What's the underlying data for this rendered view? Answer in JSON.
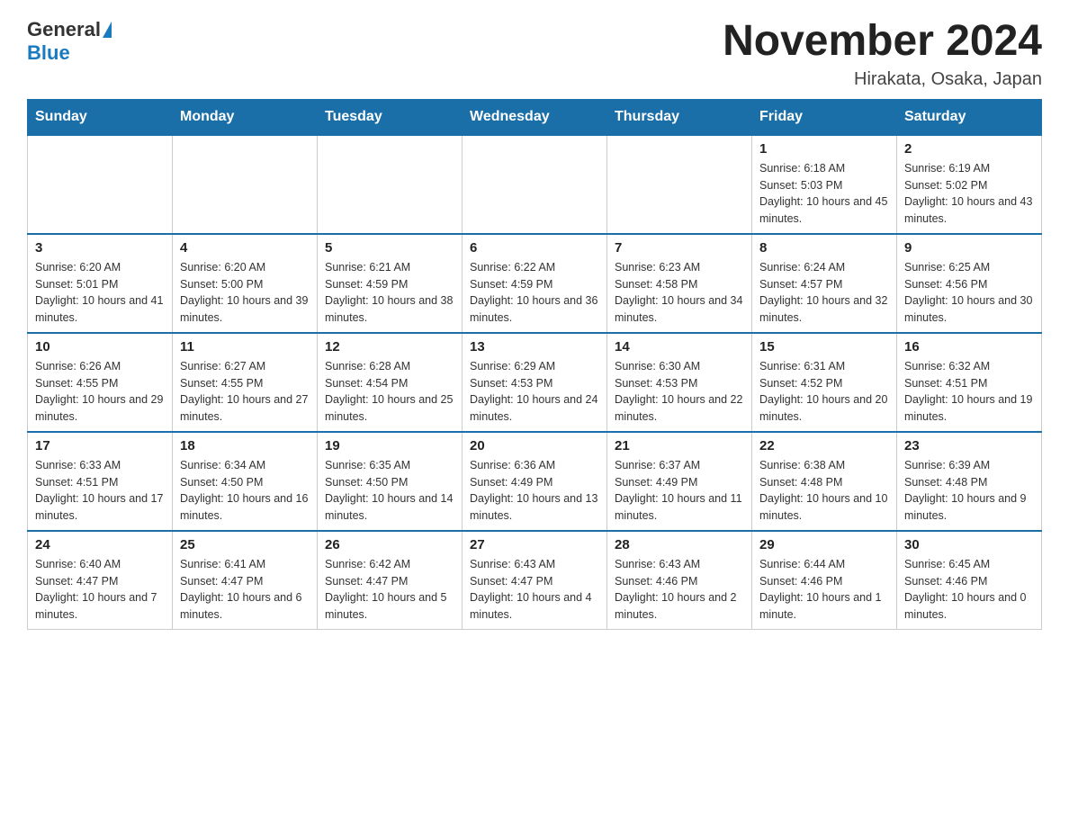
{
  "header": {
    "logo_general": "General",
    "logo_blue": "Blue",
    "month_title": "November 2024",
    "location": "Hirakata, Osaka, Japan"
  },
  "weekdays": [
    "Sunday",
    "Monday",
    "Tuesday",
    "Wednesday",
    "Thursday",
    "Friday",
    "Saturday"
  ],
  "weeks": [
    [
      {
        "day": "",
        "info": ""
      },
      {
        "day": "",
        "info": ""
      },
      {
        "day": "",
        "info": ""
      },
      {
        "day": "",
        "info": ""
      },
      {
        "day": "",
        "info": ""
      },
      {
        "day": "1",
        "info": "Sunrise: 6:18 AM\nSunset: 5:03 PM\nDaylight: 10 hours and 45 minutes."
      },
      {
        "day": "2",
        "info": "Sunrise: 6:19 AM\nSunset: 5:02 PM\nDaylight: 10 hours and 43 minutes."
      }
    ],
    [
      {
        "day": "3",
        "info": "Sunrise: 6:20 AM\nSunset: 5:01 PM\nDaylight: 10 hours and 41 minutes."
      },
      {
        "day": "4",
        "info": "Sunrise: 6:20 AM\nSunset: 5:00 PM\nDaylight: 10 hours and 39 minutes."
      },
      {
        "day": "5",
        "info": "Sunrise: 6:21 AM\nSunset: 4:59 PM\nDaylight: 10 hours and 38 minutes."
      },
      {
        "day": "6",
        "info": "Sunrise: 6:22 AM\nSunset: 4:59 PM\nDaylight: 10 hours and 36 minutes."
      },
      {
        "day": "7",
        "info": "Sunrise: 6:23 AM\nSunset: 4:58 PM\nDaylight: 10 hours and 34 minutes."
      },
      {
        "day": "8",
        "info": "Sunrise: 6:24 AM\nSunset: 4:57 PM\nDaylight: 10 hours and 32 minutes."
      },
      {
        "day": "9",
        "info": "Sunrise: 6:25 AM\nSunset: 4:56 PM\nDaylight: 10 hours and 30 minutes."
      }
    ],
    [
      {
        "day": "10",
        "info": "Sunrise: 6:26 AM\nSunset: 4:55 PM\nDaylight: 10 hours and 29 minutes."
      },
      {
        "day": "11",
        "info": "Sunrise: 6:27 AM\nSunset: 4:55 PM\nDaylight: 10 hours and 27 minutes."
      },
      {
        "day": "12",
        "info": "Sunrise: 6:28 AM\nSunset: 4:54 PM\nDaylight: 10 hours and 25 minutes."
      },
      {
        "day": "13",
        "info": "Sunrise: 6:29 AM\nSunset: 4:53 PM\nDaylight: 10 hours and 24 minutes."
      },
      {
        "day": "14",
        "info": "Sunrise: 6:30 AM\nSunset: 4:53 PM\nDaylight: 10 hours and 22 minutes."
      },
      {
        "day": "15",
        "info": "Sunrise: 6:31 AM\nSunset: 4:52 PM\nDaylight: 10 hours and 20 minutes."
      },
      {
        "day": "16",
        "info": "Sunrise: 6:32 AM\nSunset: 4:51 PM\nDaylight: 10 hours and 19 minutes."
      }
    ],
    [
      {
        "day": "17",
        "info": "Sunrise: 6:33 AM\nSunset: 4:51 PM\nDaylight: 10 hours and 17 minutes."
      },
      {
        "day": "18",
        "info": "Sunrise: 6:34 AM\nSunset: 4:50 PM\nDaylight: 10 hours and 16 minutes."
      },
      {
        "day": "19",
        "info": "Sunrise: 6:35 AM\nSunset: 4:50 PM\nDaylight: 10 hours and 14 minutes."
      },
      {
        "day": "20",
        "info": "Sunrise: 6:36 AM\nSunset: 4:49 PM\nDaylight: 10 hours and 13 minutes."
      },
      {
        "day": "21",
        "info": "Sunrise: 6:37 AM\nSunset: 4:49 PM\nDaylight: 10 hours and 11 minutes."
      },
      {
        "day": "22",
        "info": "Sunrise: 6:38 AM\nSunset: 4:48 PM\nDaylight: 10 hours and 10 minutes."
      },
      {
        "day": "23",
        "info": "Sunrise: 6:39 AM\nSunset: 4:48 PM\nDaylight: 10 hours and 9 minutes."
      }
    ],
    [
      {
        "day": "24",
        "info": "Sunrise: 6:40 AM\nSunset: 4:47 PM\nDaylight: 10 hours and 7 minutes."
      },
      {
        "day": "25",
        "info": "Sunrise: 6:41 AM\nSunset: 4:47 PM\nDaylight: 10 hours and 6 minutes."
      },
      {
        "day": "26",
        "info": "Sunrise: 6:42 AM\nSunset: 4:47 PM\nDaylight: 10 hours and 5 minutes."
      },
      {
        "day": "27",
        "info": "Sunrise: 6:43 AM\nSunset: 4:47 PM\nDaylight: 10 hours and 4 minutes."
      },
      {
        "day": "28",
        "info": "Sunrise: 6:43 AM\nSunset: 4:46 PM\nDaylight: 10 hours and 2 minutes."
      },
      {
        "day": "29",
        "info": "Sunrise: 6:44 AM\nSunset: 4:46 PM\nDaylight: 10 hours and 1 minute."
      },
      {
        "day": "30",
        "info": "Sunrise: 6:45 AM\nSunset: 4:46 PM\nDaylight: 10 hours and 0 minutes."
      }
    ]
  ]
}
